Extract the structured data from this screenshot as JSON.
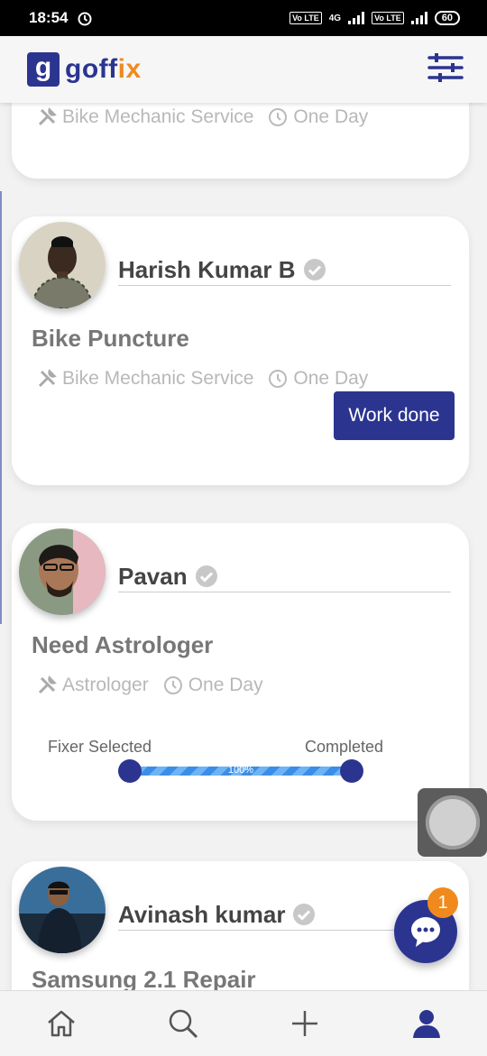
{
  "status_bar": {
    "time": "18:54",
    "network": "4G",
    "volte": "Vo LTE",
    "battery": "60"
  },
  "header": {
    "logo_mark": "g",
    "logo_text_start": "goff",
    "logo_text_accent": "ix"
  },
  "cards": [
    {
      "service": "Bike Mechanic Service",
      "duration": "One Day"
    },
    {
      "name": "Harish Kumar B",
      "title": "Bike Puncture",
      "service": "Bike Mechanic Service",
      "duration": "One Day",
      "action": "Work done"
    },
    {
      "name": "Pavan",
      "title": "Need Astrologer",
      "service": "Astrologer",
      "duration": "One Day",
      "progress": {
        "start_label": "Fixer Selected",
        "end_label": "Completed",
        "percent": 100,
        "percent_label": "100%"
      }
    },
    {
      "name": "Avinash kumar",
      "title": "Samsung 2.1 Repair"
    }
  ],
  "chat": {
    "badge": "1"
  },
  "bottom_nav": [
    "home-icon",
    "search-icon",
    "add-icon",
    "profile-icon"
  ],
  "colors": {
    "brand": "#2b3590",
    "accent": "#f08a1e"
  }
}
